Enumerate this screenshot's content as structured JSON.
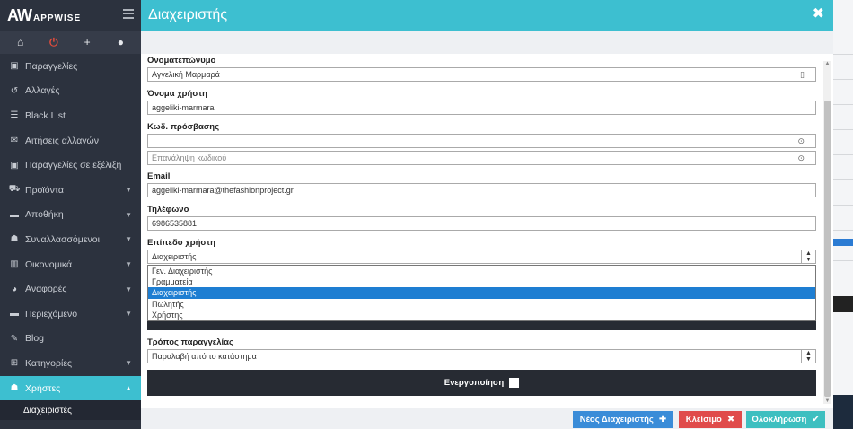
{
  "brand": {
    "logo_mark": "AW",
    "logo_text": "APPWISE"
  },
  "sidebar": {
    "top_icons": [
      {
        "icon": "home-icon",
        "glyph": "⌂"
      },
      {
        "icon": "power-icon",
        "glyph": "⏻"
      },
      {
        "icon": "add-user-icon",
        "glyph": "+"
      },
      {
        "icon": "user-icon",
        "glyph": "●"
      }
    ],
    "items": [
      {
        "label": "Παραγγελίες",
        "icon": "box-icon",
        "has_children": false
      },
      {
        "label": "Αλλαγές",
        "icon": "undo-icon",
        "has_children": false
      },
      {
        "label": "Black List",
        "icon": "list-icon",
        "has_children": false
      },
      {
        "label": "Αιτήσεις αλλαγών",
        "icon": "envelope-icon",
        "has_children": false
      },
      {
        "label": "Παραγγελίες σε εξέλιξη",
        "icon": "box-icon",
        "has_children": false
      },
      {
        "label": "Προϊόντα",
        "icon": "cart-icon",
        "has_children": true
      },
      {
        "label": "Αποθήκη",
        "icon": "folder-icon",
        "has_children": true
      },
      {
        "label": "Συναλλασσόμενοι",
        "icon": "users-icon",
        "has_children": true
      },
      {
        "label": "Οικονομικά",
        "icon": "bar-chart-icon",
        "has_children": true
      },
      {
        "label": "Αναφορές",
        "icon": "pie-chart-icon",
        "has_children": true
      },
      {
        "label": "Περιεχόμενο",
        "icon": "folder-icon",
        "has_children": true
      },
      {
        "label": "Blog",
        "icon": "pencil-icon",
        "has_children": false
      },
      {
        "label": "Κατηγορίες",
        "icon": "sitemap-icon",
        "has_children": true
      },
      {
        "label": "Χρήστες",
        "icon": "users-icon",
        "has_children": true,
        "active": true
      }
    ],
    "sub_item": "Διαχειριστές"
  },
  "modal": {
    "title": "Διαχειριστής",
    "fields": {
      "fullname_label": "Ονοματεπώνυμο",
      "fullname_value": "Αγγελική Μαρμαρά",
      "username_label": "Όνομα χρήστη",
      "username_value": "aggeliki-marmara",
      "password_label": "Κωδ. πρόσβασης",
      "password_value": "",
      "password_repeat_placeholder": "Επανάληψη κωδικού",
      "email_label": "Email",
      "email_value": "aggeliki-marmara@thefashionproject.gr",
      "phone_label": "Τηλέφωνο",
      "phone_value": "6986535881",
      "level_label": "Επίπεδο χρήστη",
      "level_value": "Διαχειριστής",
      "level_options": [
        "Γεν. Διαχειριστής",
        "Γραμματεία",
        "Διαχειριστής",
        "Πωλητής",
        "Χρήστης"
      ],
      "level_selected_index": 2,
      "order_method_label": "Τρόπος παραγγελίας",
      "order_method_value": "Παραλαβή από το κατάστημα",
      "activation_label": "Ενεργοποίηση",
      "activation_checked": false
    },
    "buttons": {
      "new_admin": "Νέος Διαχειριστής",
      "close": "Κλείσιμο",
      "complete": "Ολοκλήρωση"
    }
  },
  "colors": {
    "accent": "#3dbfd0",
    "sidebar_bg": "#2c323e",
    "primary_button": "#3a8cd8",
    "danger_button": "#e04b4b",
    "success_button": "#3dbfc0",
    "selected_option": "#1e7ed2"
  }
}
